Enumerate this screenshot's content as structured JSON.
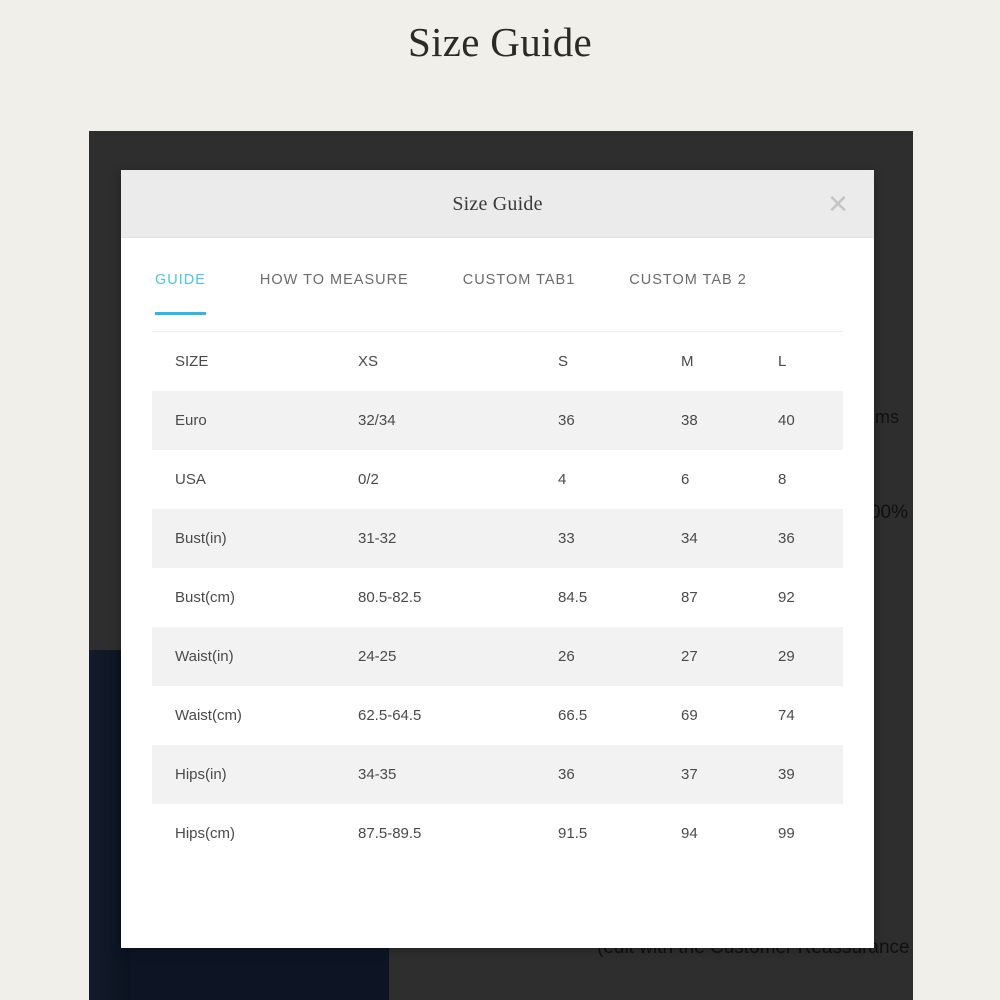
{
  "page": {
    "title": "Size Guide",
    "background_color": "#f1efe9"
  },
  "background_page": {
    "overlay_color": "#2e2e2e",
    "photo_color": "#0d1524",
    "visible_text_fragments": [
      "ms",
      "00%",
      "(edit with the Customer Reassurance m"
    ]
  },
  "modal": {
    "title": "Size Guide",
    "close_icon": "close-icon",
    "close_glyph": "✕",
    "accent_color": "#2bb8e8",
    "header_background": "#ebebeb",
    "tabs": [
      {
        "label": "GUIDE",
        "active": true
      },
      {
        "label": "HOW TO MEASURE",
        "active": false
      },
      {
        "label": "CUSTOM TAB1",
        "active": false
      },
      {
        "label": "CUSTOM TAB 2",
        "active": false
      }
    ],
    "table": {
      "headers": [
        "SIZE",
        "XS",
        "S",
        "M",
        "L"
      ],
      "rows": [
        {
          "label": "Euro",
          "values": [
            "32/34",
            "36",
            "38",
            "40"
          ]
        },
        {
          "label": "USA",
          "values": [
            "0/2",
            "4",
            "6",
            "8"
          ]
        },
        {
          "label": "Bust(in)",
          "values": [
            "31-32",
            "33",
            "34",
            "36"
          ]
        },
        {
          "label": "Bust(cm)",
          "values": [
            "80.5-82.5",
            "84.5",
            "87",
            "92"
          ]
        },
        {
          "label": "Waist(in)",
          "values": [
            "24-25",
            "26",
            "27",
            "29"
          ]
        },
        {
          "label": "Waist(cm)",
          "values": [
            "62.5-64.5",
            "66.5",
            "69",
            "74"
          ]
        },
        {
          "label": "Hips(in)",
          "values": [
            "34-35",
            "36",
            "37",
            "39"
          ]
        },
        {
          "label": "Hips(cm)",
          "values": [
            "87.5-89.5",
            "91.5",
            "94",
            "99"
          ]
        }
      ]
    }
  }
}
